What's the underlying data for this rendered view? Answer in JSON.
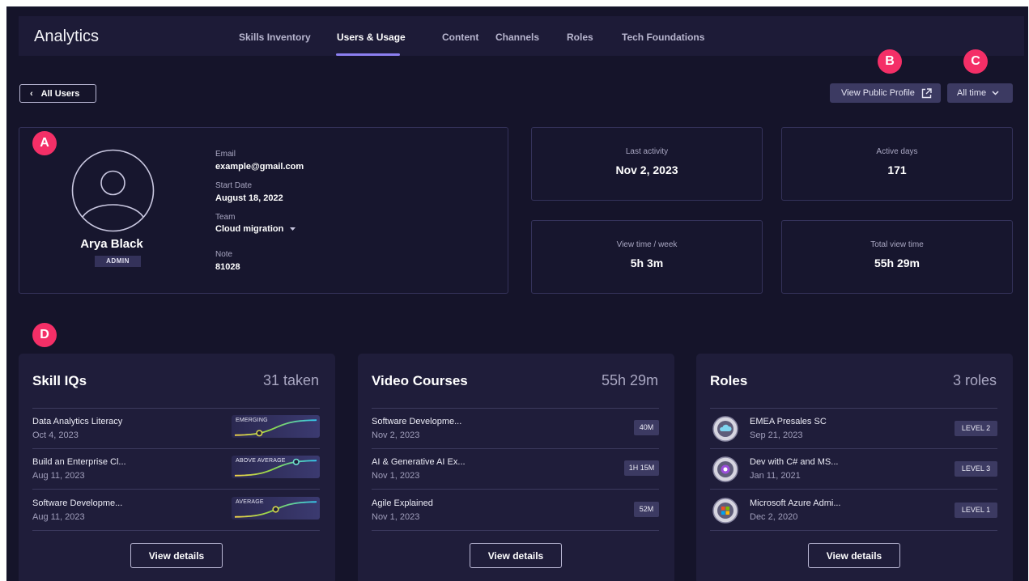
{
  "nav": {
    "title": "Analytics",
    "tabs": [
      {
        "label": "Skills Inventory"
      },
      {
        "label": "Users & Usage"
      },
      {
        "label": "Content"
      },
      {
        "label": "Channels"
      },
      {
        "label": "Roles"
      },
      {
        "label": "Tech Foundations"
      }
    ],
    "active_tab": "Users & Usage"
  },
  "controls": {
    "back_label": "All Users",
    "view_profile_label": "View Public Profile",
    "time_range": "All time"
  },
  "markers": {
    "a": "A",
    "b": "B",
    "c": "C",
    "d": "D"
  },
  "profile": {
    "name": "Arya Black",
    "role_badge": "ADMIN",
    "email_label": "Email",
    "email": "example@gmail.com",
    "start_label": "Start Date",
    "start_date": "August 18, 2022",
    "team_label": "Team",
    "team": "Cloud migration",
    "note_label": "Note",
    "note": "81028"
  },
  "stats": [
    {
      "label": "Last activity",
      "value": "Nov 2, 2023"
    },
    {
      "label": "Active days",
      "value": "171"
    },
    {
      "label": "View time / week",
      "value": "5h 3m"
    },
    {
      "label": "Total view time",
      "value": "55h 29m"
    }
  ],
  "skill_iqs": {
    "title": "Skill IQs",
    "summary": "31 taken",
    "items": [
      {
        "title": "Data Analytics Literacy",
        "date": "Oct 4, 2023",
        "level": "EMERGING",
        "position": 0.3
      },
      {
        "title": "Build an Enterprise Cl...",
        "date": "Aug 11, 2023",
        "level": "ABOVE AVERAGE",
        "position": 0.75
      },
      {
        "title": "Software Developme...",
        "date": "Aug 11, 2023",
        "level": "AVERAGE",
        "position": 0.5
      }
    ],
    "button": "View details"
  },
  "video_courses": {
    "title": "Video Courses",
    "summary": "55h 29m",
    "items": [
      {
        "title": "Software Developme...",
        "date": "Nov 2, 2023",
        "duration": "40M"
      },
      {
        "title": "AI & Generative AI Ex...",
        "date": "Nov 1, 2023",
        "duration": "1H 15M"
      },
      {
        "title": "Agile Explained",
        "date": "Nov 1, 2023",
        "duration": "52M"
      }
    ],
    "button": "View details"
  },
  "roles": {
    "title": "Roles",
    "summary": "3 roles",
    "items": [
      {
        "title": "EMEA Presales SC",
        "date": "Sep 21, 2023",
        "level": "LEVEL 2",
        "icon": "cloud-icon"
      },
      {
        "title": "Dev with C# and MS...",
        "date": "Jan 11, 2021",
        "level": "LEVEL 3",
        "icon": "csharp-icon"
      },
      {
        "title": "Microsoft Azure Admi...",
        "date": "Dec 2, 2020",
        "level": "LEVEL 1",
        "icon": "microsoft-icon"
      }
    ],
    "button": "View details"
  },
  "colors": {
    "background": "#15142a",
    "panel": "#1f1d3a",
    "accent": "#8c7ff0",
    "marker": "#f42f67"
  }
}
